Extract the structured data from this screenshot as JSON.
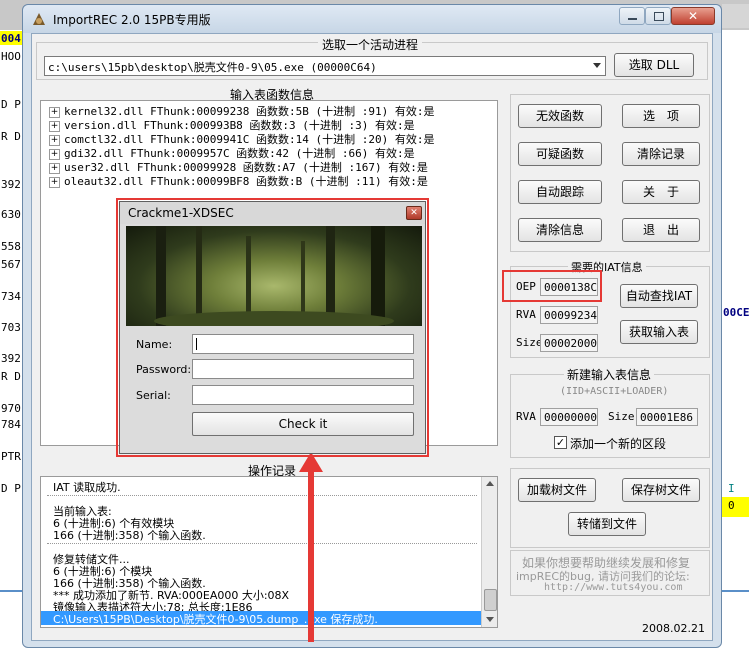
{
  "background": {
    "left_fragments": [
      "004",
      "HOO",
      "D P",
      "R D",
      "392",
      "630",
      "558",
      "567",
      "734",
      "703",
      "392",
      "R D",
      "970",
      "784",
      "PTR",
      "D P"
    ],
    "right_fragments": [
      "00CE",
      "I",
      "0"
    ]
  },
  "window": {
    "title": "ImportREC 2.0 15PB专用版",
    "min_icon": "minimize-icon",
    "max_icon": "maximize-icon",
    "close_icon": "close-icon"
  },
  "process": {
    "group_label": "选取一个活动进程",
    "selected": "c:\\users\\15pb\\desktop\\脱壳文件0-9\\05.exe  (00000C64)",
    "pick_dll": "选取 DLL"
  },
  "imports": {
    "group_label": "输入表函数信息",
    "rows": [
      "kernel32.dll FThunk:00099238 函数数:5B (十进制 :91) 有效:是",
      "version.dll FThunk:000993B8 函数数:3 (十进制 :3) 有效:是",
      "comctl32.dll FThunk:0009941C 函数数:14 (十进制 :20) 有效:是",
      "gdi32.dll FThunk:0009957C 函数数:42 (十进制 :66) 有效:是",
      "user32.dll FThunk:00099928 函数数:A7 (十进制 :167) 有效:是",
      "oleaut32.dll FThunk:00099BF8 函数数:B (十进制 :11) 有效:是"
    ]
  },
  "side_buttons": {
    "invalid_funcs": "无效函数",
    "options": "选　项",
    "suspicious": "可疑函数",
    "clear_log": "清除记录",
    "auto_trace": "自动跟踪",
    "about": "关　于",
    "clear_info": "清除信息",
    "exit": "退　出"
  },
  "iat": {
    "group_label": "需要的IAT信息",
    "oep_label": "OEP",
    "oep_value": "0000138C",
    "rva_label": "RVA",
    "rva_value": "00099234",
    "size_label": "Size",
    "size_value": "00002000",
    "auto_find": "自动查找IAT",
    "get_imports": "获取输入表"
  },
  "new_import": {
    "group_label": "新建输入表信息",
    "sub_label": "(IID+ASCII+LOADER)",
    "rva_label": "RVA",
    "rva_value": "00000000",
    "size_label": "Size",
    "size_value": "00001E86",
    "add_section": "添加一个新的区段"
  },
  "log": {
    "group_label": "操作记录",
    "lines": [
      "IAT 读取成功.",
      "",
      "当前输入表:",
      "6 (十进制:6) 个有效模块",
      "166 (十进制:358) 个输入函数.",
      "",
      "修复转储文件...",
      "6 (十进制:6) 个模块",
      "166 (十进制:358) 个输入函数.",
      "*** 成功添加了新节. RVA:000EA000 大小:08X",
      "镜像输入表描述符大小:78; 总长度:1E86"
    ],
    "selected_line": "C:\\Users\\15PB\\Desktop\\脱壳文件0-9\\05.dump_.exe 保存成功."
  },
  "tree_buttons": {
    "load_tree": "加载树文件",
    "save_tree": "保存树文件",
    "dump_file": "转储到文件"
  },
  "footer": {
    "help_line1": "如果你想要帮助继续发展和修复",
    "help_line2": "impREC的bug, 请访问我们的论坛:",
    "url": "http://www.tuts4you.com",
    "date": "2008.02.21"
  },
  "crackme": {
    "title": "Crackme1-XDSEC",
    "close_icon": "close-icon",
    "name_label": "Name:",
    "name_value": "",
    "password_label": "Password:",
    "password_value": "",
    "serial_label": "Serial:",
    "serial_value": "",
    "check_button": "Check it"
  },
  "colors": {
    "highlight_red": "#e53935",
    "selection_blue": "#3399ff",
    "window_frame": "#d4e0ec",
    "bg_yellow": "#ffff00"
  }
}
